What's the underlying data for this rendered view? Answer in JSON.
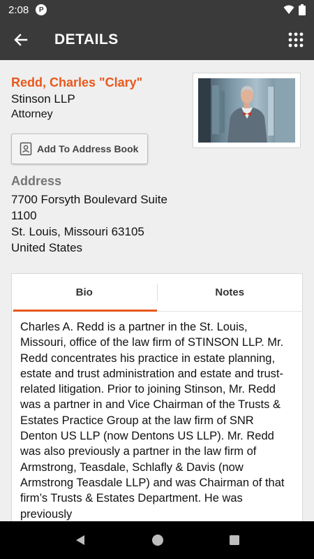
{
  "status_bar": {
    "time": "2:08"
  },
  "app_bar": {
    "title": "DETAILS"
  },
  "contact": {
    "name": "Redd, Charles \"Clary\"",
    "firm": "Stinson LLP",
    "title": "Attorney"
  },
  "actions": {
    "add_to_address_book": "Add To Address Book"
  },
  "address": {
    "label": "Address",
    "lines": [
      "7700 Forsyth Boulevard Suite 1100",
      "St. Louis, Missouri 63105",
      "United States"
    ]
  },
  "tabs": [
    {
      "label": "Bio",
      "active": true
    },
    {
      "label": "Notes",
      "active": false
    }
  ],
  "bio": "Charles A. Redd is a partner in the St. Louis, Missouri, office of the law firm of STINSON LLP. Mr. Redd concentrates his practice in estate planning, estate and trust administration and estate and trust-related litigation. Prior to joining Stinson, Mr. Redd was a partner in and Vice Chairman of the Trusts & Estates Practice Group at the law firm of SNR Denton US LLP (now Dentons US LLP). Mr. Redd was also previously a partner in the law firm of Armstrong, Teasdale, Schlafly & Davis (now Armstrong Teasdale LLP) and was Chairman of that firm’s Trusts & Estates Department. He was previously",
  "colors": {
    "accent": "#e8581c",
    "app_bar": "#3a3a3a",
    "background": "#efefef"
  },
  "icons": {
    "status_app": "app-notification-icon",
    "wifi": "wifi-icon",
    "battery": "battery-icon",
    "back": "arrow-back-icon",
    "menu": "grid-menu-icon",
    "contact_card": "contact-card-icon",
    "nav_back": "nav-back-icon",
    "nav_home": "nav-home-icon",
    "nav_recents": "nav-recents-icon"
  }
}
